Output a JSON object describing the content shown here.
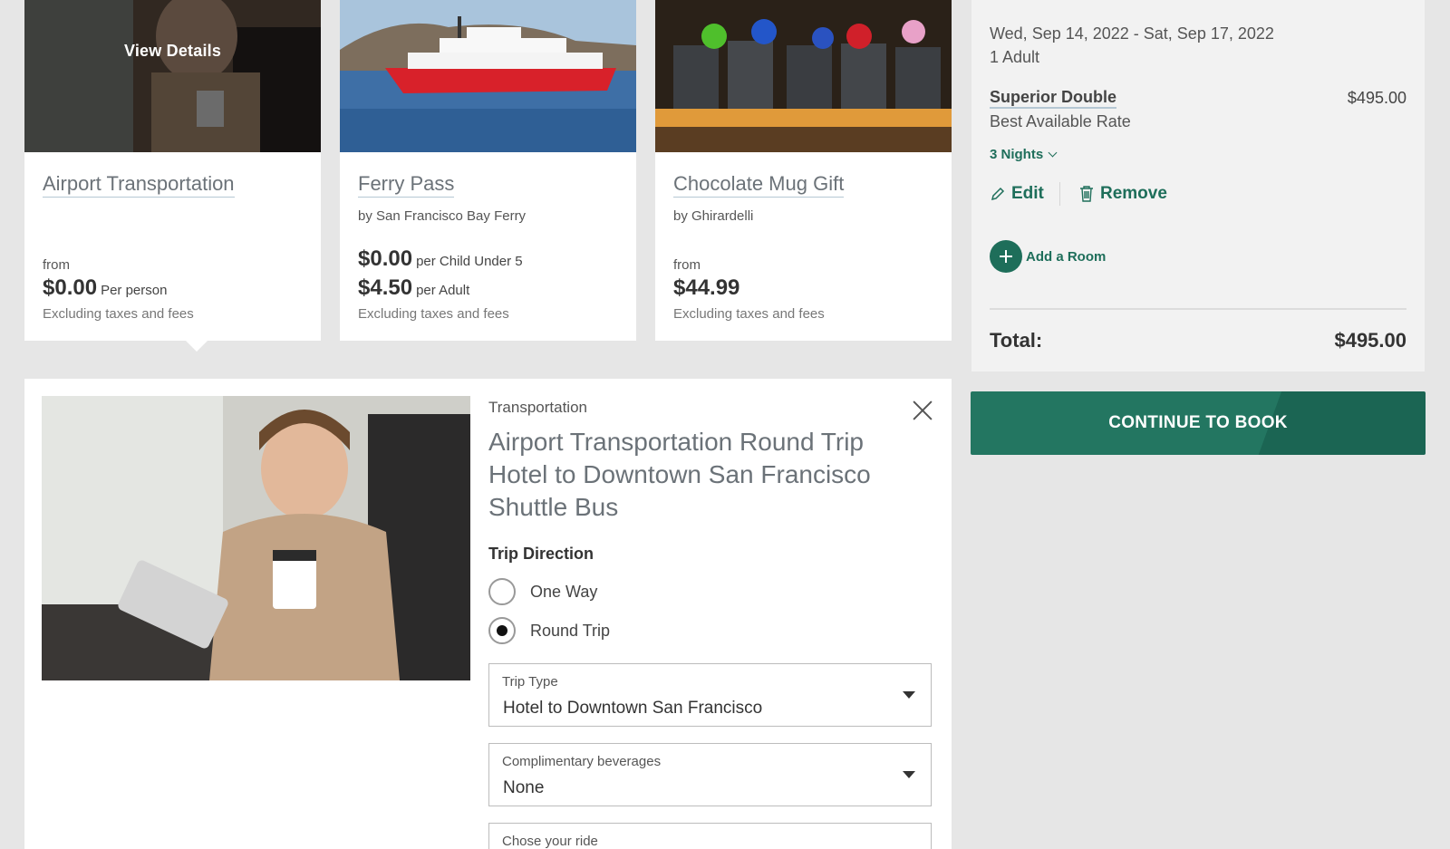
{
  "addons": [
    {
      "title": "Airport Transportation",
      "overlay_label": "View Details",
      "from_label": "from",
      "price": "$0.00",
      "unit": "Per person",
      "note": "Excluding taxes and fees"
    },
    {
      "title": "Ferry Pass",
      "vendor": "by San Francisco Bay Ferry",
      "price_child": "$0.00",
      "unit_child": "per Child Under 5",
      "price_adult": "$4.50",
      "unit_adult": "per Adult",
      "note": "Excluding taxes and fees"
    },
    {
      "title": "Chocolate Mug Gift",
      "vendor": "by Ghirardelli",
      "from_label": "from",
      "price": "$44.99",
      "note": "Excluding taxes and fees"
    }
  ],
  "details": {
    "category": "Transportation",
    "heading": "Airport Transportation Round Trip Hotel to Downtown San Francisco Shuttle Bus",
    "trip_direction_label": "Trip Direction",
    "options": [
      "One Way",
      "Round Trip"
    ],
    "selected_option": "Round Trip",
    "selects": [
      {
        "label": "Trip Type",
        "value": "Hotel to Downtown San Francisco"
      },
      {
        "label": "Complimentary beverages",
        "value": "None"
      },
      {
        "label": "Chose your ride",
        "value": ""
      }
    ]
  },
  "summary": {
    "dates": "Wed, Sep 14, 2022 - Sat, Sep 17, 2022",
    "guests": "1 Adult",
    "room_name": "Superior Double",
    "room_price": "$495.00",
    "rate_name": "Best Available Rate",
    "nights": "3 Nights",
    "edit_label": "Edit",
    "remove_label": "Remove",
    "add_room_label": "Add a Room",
    "total_label": "Total:",
    "total_value": "$495.00"
  },
  "cta_label": "CONTINUE TO BOOK",
  "colors": {
    "accent": "#1e6e5a",
    "cta": "#237661",
    "page_bg": "#e6e6e6"
  },
  "icons": [
    "close-icon",
    "pencil-icon",
    "trash-icon",
    "plus-icon",
    "chevron-down-icon",
    "caret-down-icon"
  ]
}
